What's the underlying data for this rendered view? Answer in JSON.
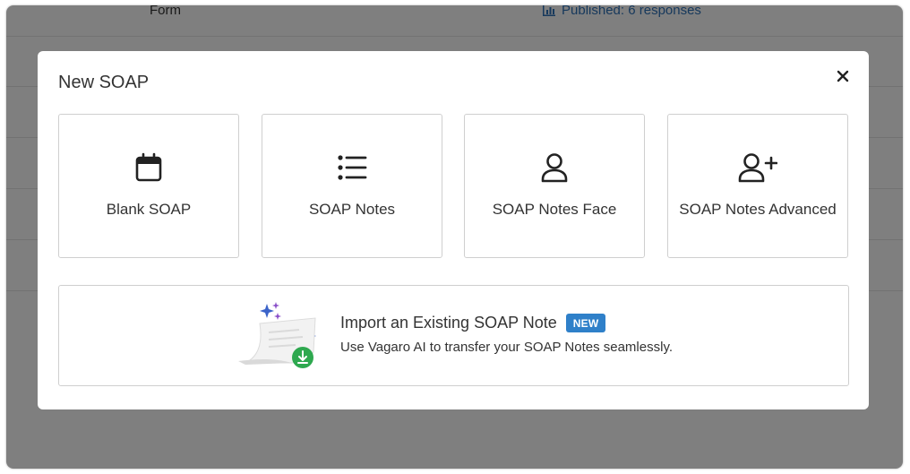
{
  "background": {
    "form_label": "Form",
    "published_text": "Published: 6 responses"
  },
  "modal": {
    "title": "New SOAP",
    "close_icon": "close-icon",
    "templates": [
      {
        "label": "Blank SOAP",
        "icon": "calendar-icon"
      },
      {
        "label": "SOAP Notes",
        "icon": "list-icon"
      },
      {
        "label": "SOAP Notes Face",
        "icon": "person-icon"
      },
      {
        "label": "SOAP Notes Advanced",
        "icon": "person-add-icon"
      }
    ],
    "import": {
      "title": "Import an Existing SOAP Note",
      "badge": "NEW",
      "description": "Use Vagaro AI to transfer your SOAP Notes seamlessly.",
      "illustration": "ai-import-illustration"
    }
  },
  "colors": {
    "overlay": "#7a7a7a",
    "badge": "#2f80c9",
    "link": "#2f72b8",
    "download_badge": "#2ea84f",
    "sparkle_blue": "#3b63c9",
    "sparkle_purple": "#8a4fc9"
  }
}
